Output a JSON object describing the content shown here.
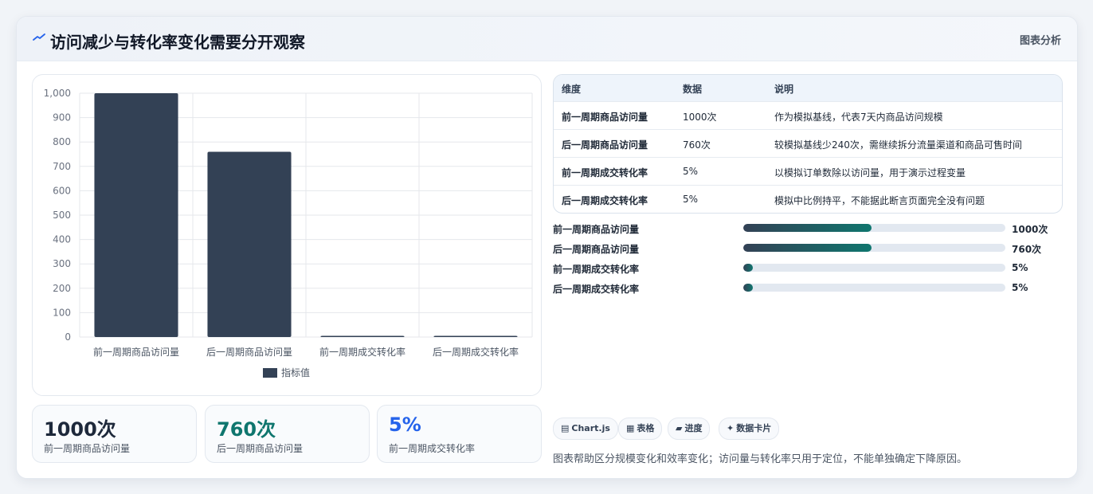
{
  "header": {
    "title": "访问减少与转化率变化需要分开观察",
    "tag": "图表分析",
    "icon": "trend-icon"
  },
  "chart_data": {
    "type": "bar",
    "categories": [
      "前一周期商品访问量",
      "后一周期商品访问量",
      "前一周期成交转化率",
      "后一周期成交转化率"
    ],
    "series": [
      {
        "name": "指标值",
        "values": [
          1000,
          760,
          5,
          5
        ],
        "color": "#334155"
      }
    ],
    "ylim": [
      0,
      1000
    ],
    "yticks": [
      0,
      100,
      200,
      300,
      400,
      500,
      600,
      700,
      800,
      900,
      1000
    ],
    "ytick_labels": [
      "0",
      "100",
      "200",
      "300",
      "400",
      "500",
      "600",
      "700",
      "800",
      "900",
      "1,000"
    ],
    "grid": true,
    "legend": "bottom"
  },
  "stats": [
    {
      "value": "1000次",
      "label": "前一周期商品访问量",
      "color": "#1e293b"
    },
    {
      "value": "760次",
      "label": "后一周期商品访问量",
      "color": "#0f766e"
    },
    {
      "value": "5%",
      "label": "前一周期成交转化率",
      "color": "#2563eb"
    }
  ],
  "table": {
    "headers": [
      "维度",
      "数据",
      "说明"
    ],
    "rows": [
      [
        "前一周期商品访问量",
        "1000次",
        "作为模拟基线，代表7天内商品访问规模"
      ],
      [
        "后一周期商品访问量",
        "760次",
        "较模拟基线少240次，需继续拆分流量渠道和商品可售时间"
      ],
      [
        "前一周期成交转化率",
        "5%",
        "以模拟订单数除以访问量，用于演示过程变量"
      ],
      [
        "后一周期成交转化率",
        "5%",
        "模拟中比例持平，不能据此断言页面完全没有问题"
      ]
    ]
  },
  "progress": [
    {
      "label": "前一周期商品访问量",
      "value": "1000次",
      "fill": 0.49
    },
    {
      "label": "后一周期商品访问量",
      "value": "760次",
      "fill": 0.49
    },
    {
      "label": "前一周期成交转化率",
      "value": "5%",
      "fill": 0.035
    },
    {
      "label": "后一周期成交转化率",
      "value": "5%",
      "fill": 0.035
    }
  ],
  "chips": [
    {
      "icon": "▤",
      "label": "Chart.js"
    },
    {
      "icon": "▦",
      "label": "表格"
    },
    {
      "icon": "▰",
      "label": "进度"
    },
    {
      "icon": "✦",
      "label": "数据卡片"
    }
  ],
  "note": "图表帮助区分规模变化和效率变化；访问量与转化率只用于定位，不能单独确定下降原因。"
}
